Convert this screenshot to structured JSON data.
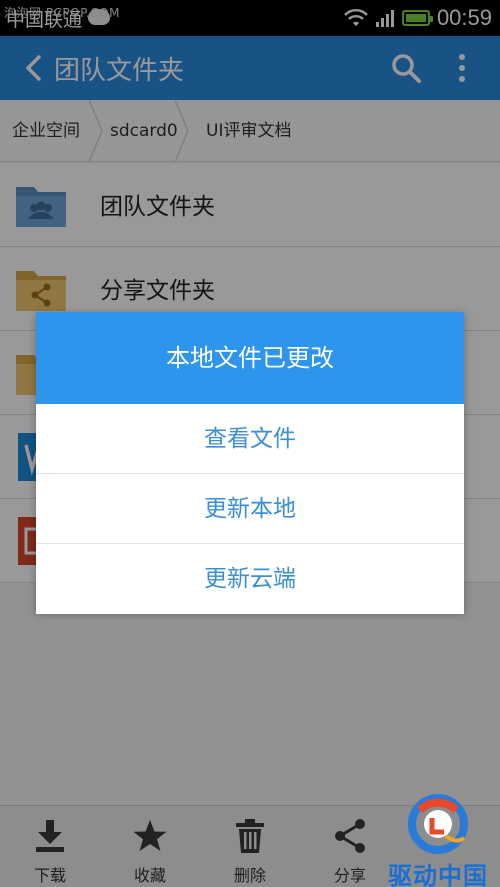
{
  "status_bar": {
    "carrier": "中国联通",
    "watermark": "泡泡网 PCPOP.COM",
    "time": "00:59",
    "battery_level": 1.0
  },
  "app_bar": {
    "title": "团队文件夹",
    "back_icon": "chevron-left-icon",
    "search_icon": "search-icon",
    "more_icon": "more-vertical-icon"
  },
  "breadcrumb": {
    "items": [
      {
        "label": "企业空间"
      },
      {
        "label": "sdcard0"
      },
      {
        "label": "UI评审文档"
      }
    ]
  },
  "list": {
    "items": [
      {
        "name": "团队文件夹",
        "icon": "team-folder-icon"
      },
      {
        "name": "分享文件夹",
        "icon": "share-folder-icon"
      },
      {
        "name": "",
        "icon": "folder-icon"
      },
      {
        "name": "",
        "icon": "word-doc-icon"
      },
      {
        "name": "",
        "icon": "ppt-doc-icon"
      }
    ]
  },
  "dialog": {
    "title": "本地文件已更改",
    "options": [
      {
        "label": "查看文件"
      },
      {
        "label": "更新本地"
      },
      {
        "label": "更新云端"
      }
    ]
  },
  "bottom_bar": {
    "items": [
      {
        "label": "下载",
        "icon": "download-icon"
      },
      {
        "label": "收藏",
        "icon": "star-icon"
      },
      {
        "label": "删除",
        "icon": "trash-icon"
      },
      {
        "label": "分享",
        "icon": "share-icon"
      }
    ]
  },
  "logo": {
    "text": "驱动中国"
  },
  "colors": {
    "primary": "#2a8ae0",
    "dialog_header": "#2e95ec",
    "option_text": "#3b8fd6",
    "battery": "#78d64a"
  }
}
